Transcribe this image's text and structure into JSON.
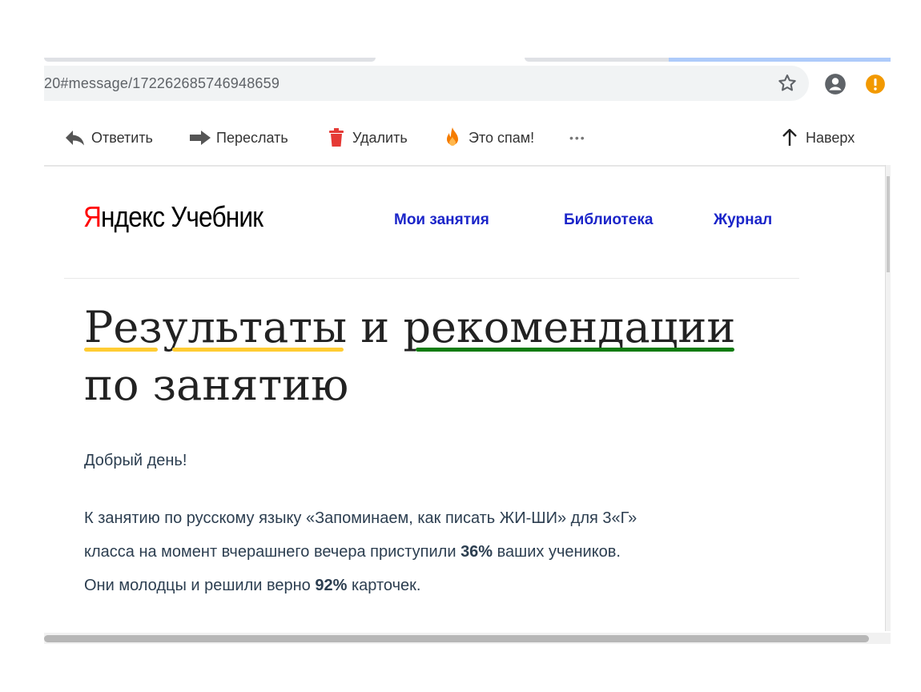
{
  "browser": {
    "url": "20#message/172262685746948659"
  },
  "mail_toolbar": {
    "reply": "Ответить",
    "forward": "Переслать",
    "delete": "Удалить",
    "spam": "Это спам!",
    "more": "•••",
    "up": "Наверх"
  },
  "logo": {
    "ya": "Я",
    "ndex": "ндекс",
    "uchebnik": "Учебник"
  },
  "nav": {
    "my_lessons": "Мои занятия",
    "library": "Библиотека",
    "journal": "Журнал"
  },
  "heading": {
    "line1": "Результаты и рекомендации",
    "line2": "по занятию"
  },
  "body": {
    "greeting": "Добрый день!",
    "line1": "К занятию по русскому языку «Запоминаем, как писать ЖИ-ШИ» для 3«Г»",
    "line2_pre": "класса на момент вчерашнего вечера приступили ",
    "line2_pct": "36%",
    "line2_post": " ваших учеников.",
    "line3_pre": "Они молодцы и решили верно ",
    "line3_pct": "92%",
    "line3_post": " карточек."
  },
  "colors": {
    "nav_link": "#1b25c9",
    "underline_yellow": "#ffcc33",
    "underline_green": "#107c10",
    "logo_red": "#ff0000",
    "delete_red": "#e53935",
    "spam_orange": "#f57c00",
    "extension_orange": "#f29900"
  }
}
